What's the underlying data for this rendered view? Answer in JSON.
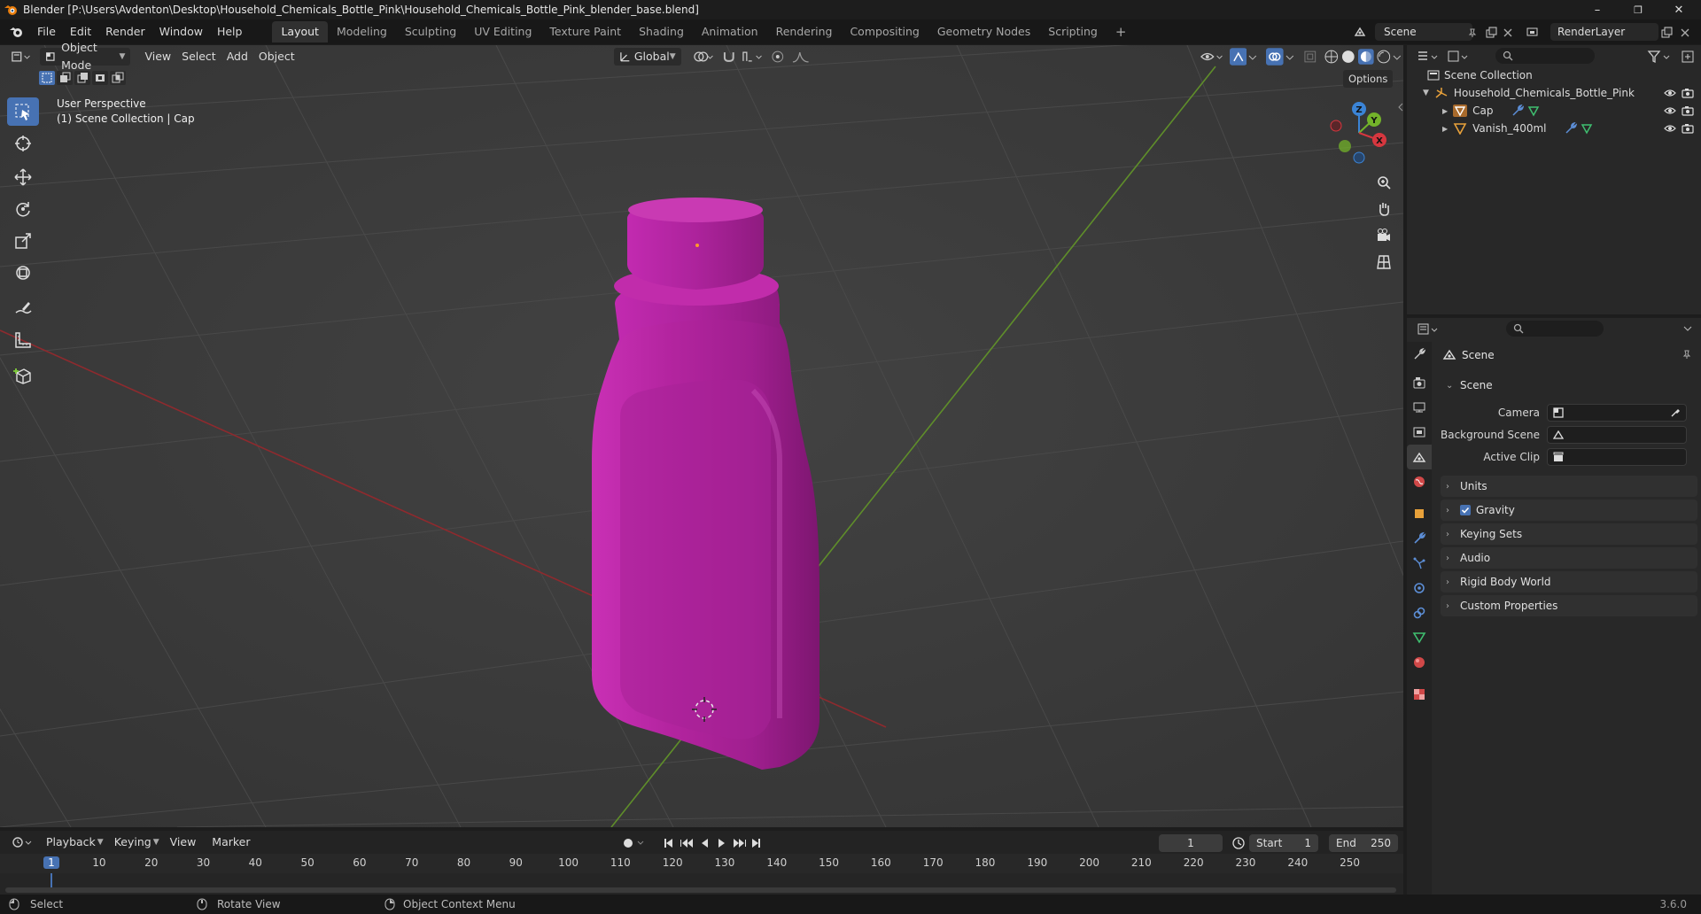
{
  "window": {
    "title": "Blender [P:\\Users\\Avdenton\\Desktop\\Household_Chemicals_Bottle_Pink\\Household_Chemicals_Bottle_Pink_blender_base.blend]",
    "minimize": "–",
    "maximize": "❐",
    "close": "✕"
  },
  "menu": [
    "File",
    "Edit",
    "Render",
    "Window",
    "Help"
  ],
  "workspaces": [
    "Layout",
    "Modeling",
    "Sculpting",
    "UV Editing",
    "Texture Paint",
    "Shading",
    "Animation",
    "Rendering",
    "Compositing",
    "Geometry Nodes",
    "Scripting"
  ],
  "workspace_add": "+",
  "scene_name": "Scene",
  "view_layer": "RenderLayer",
  "viewport": {
    "mode": "Object Mode",
    "menus": [
      "View",
      "Select",
      "Add",
      "Object"
    ],
    "orientation": "Global",
    "options": "Options",
    "info_line1": "User Perspective",
    "info_line2": "(1) Scene Collection | Cap",
    "gizmo": {
      "x": "X",
      "y": "Y",
      "z": "Z"
    },
    "bottle_color": "#a01f8f"
  },
  "outliner": {
    "root": "Scene Collection",
    "items": [
      {
        "name": "Household_Chemicals_Bottle_Pink",
        "type": "empty"
      },
      {
        "name": "Cap",
        "type": "mesh"
      },
      {
        "name": "Vanish_400ml",
        "type": "mesh"
      }
    ]
  },
  "properties": {
    "header": "Scene",
    "panel_scene": "Scene",
    "fields": [
      {
        "label": "Camera"
      },
      {
        "label": "Background Scene"
      },
      {
        "label": "Active Clip"
      }
    ],
    "panels": [
      "Units",
      "Gravity",
      "Keying Sets",
      "Audio",
      "Rigid Body World",
      "Custom Properties"
    ],
    "gravity_checked": true
  },
  "timeline": {
    "menus": [
      "Playback",
      "Keying",
      "View",
      "Marker"
    ],
    "current_frame": "1",
    "start_label": "Start",
    "start": "1",
    "end_label": "End",
    "end": "250",
    "ticks": [
      "1",
      "10",
      "20",
      "30",
      "40",
      "50",
      "60",
      "70",
      "80",
      "90",
      "100",
      "110",
      "120",
      "130",
      "140",
      "150",
      "160",
      "170",
      "180",
      "190",
      "200",
      "210",
      "220",
      "230",
      "240",
      "250"
    ]
  },
  "status": {
    "select": "Select",
    "rotate": "Rotate View",
    "context": "Object Context Menu",
    "version": "3.6.0"
  },
  "colors": {
    "accent": "#4772b3",
    "axis_x": "#d6373f",
    "axis_y": "#73b32a",
    "axis_z": "#3b84d6",
    "bottle": "#a01f8f"
  }
}
